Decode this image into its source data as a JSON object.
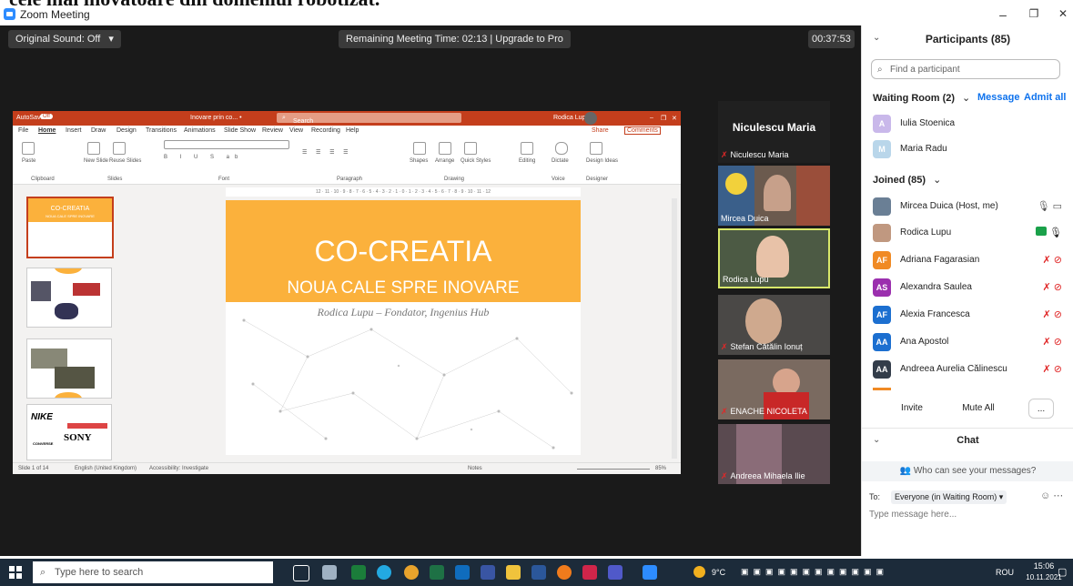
{
  "banner": {
    "text": "cele mai inovatoare din domeniul robotizat."
  },
  "window": {
    "title": "Zoom Meeting",
    "minimize": "–",
    "maximize": "❐",
    "close": "✕"
  },
  "meeting": {
    "sound": "Original Sound: Off",
    "sound_caret": "▾",
    "remaining": "Remaining Meeting Time: 02:13 | Upgrade to Pro",
    "timer": "00:37:53"
  },
  "ppt": {
    "autosave": "AutoSave",
    "autosave_state": "Off",
    "doc": "Inovare prin co... •",
    "search": "Search",
    "user": "Rodica Lupu",
    "menu": [
      "File",
      "Home",
      "Insert",
      "Draw",
      "Design",
      "Transitions",
      "Animations",
      "Slide Show",
      "Review",
      "View",
      "Recording",
      "Help"
    ],
    "share": "Share",
    "comments": "Comments",
    "groups": [
      "Clipboard",
      "Slides",
      "Font",
      "Paragraph",
      "Drawing",
      "Voice",
      "Designer"
    ],
    "tools": {
      "paste": "Paste",
      "new_slide": "New Slide",
      "reuse": "Reuse Slides",
      "shapes": "Shapes",
      "arrange": "Arrange",
      "quick_styles": "Quick Styles",
      "editing": "Editing",
      "dictate": "Dictate",
      "design_ideas": "Design Ideas"
    },
    "ruler": "12 · 11 · 10 · 9 · 8 · 7 · 6 · 5 · 4 · 3 · 2 · 1 · 0 · 1 · 2 · 3 · 4 · 5 · 6 · 7 · 8 · 9 · 10 · 11 · 12",
    "thumbs": [
      {
        "num": "1",
        "title": "CO-CREATIA",
        "subtitle": "NOUA CALE SPRE INOVARE"
      },
      {
        "num": "2"
      },
      {
        "num": "3"
      },
      {
        "num": "4",
        "brand1": "NIKE",
        "brand2": "SONY",
        "brand3": "CONVERSE"
      }
    ],
    "slide": {
      "title": "CO-CREATIA",
      "subtitle": "NOUA CALE SPRE INOVARE",
      "author": "Rodica Lupu – Fondator, Ingenius Hub"
    },
    "status": {
      "slide": "Slide 1 of 14",
      "lang": "English (United Kingdom)",
      "access": "Accessibility: Investigate",
      "notes": "Notes",
      "zoom": "85%"
    }
  },
  "tiles": [
    {
      "name": "Niculescu Maria",
      "header": "Niculescu Maria",
      "muted": true
    },
    {
      "name": "Mircea Duica",
      "muted": false
    },
    {
      "name": "Rodica Lupu",
      "muted": false,
      "active": true
    },
    {
      "name": "Stefan Cătălin Ionuț",
      "muted": true
    },
    {
      "name": "ENACHE NICOLETA",
      "muted": true
    },
    {
      "name": "Andreea Mihaela Ilie",
      "muted": true
    }
  ],
  "panel": {
    "title": "Participants (85)",
    "search_placeholder": "Find a participant",
    "waiting": "Waiting Room (2)",
    "message": "Message",
    "admit_all": "Admit all",
    "waiting_list": [
      {
        "initial": "A",
        "name": "Iulia Stoenica",
        "color": "#c9b8ea"
      },
      {
        "initial": "M",
        "name": "Maria Radu",
        "color": "#b9d6ea"
      }
    ],
    "joined": "Joined (85)",
    "joined_list": [
      {
        "initial": "",
        "name": "Mircea Duica (Host, me)",
        "color": "#6a7f95",
        "photo": true
      },
      {
        "initial": "",
        "name": "Rodica Lupu",
        "color": "#c09880",
        "photo": true
      },
      {
        "initial": "AF",
        "name": "Adriana Fagarasian",
        "color": "#f08a24"
      },
      {
        "initial": "AS",
        "name": "Alexandra Saulea",
        "color": "#9b2fae"
      },
      {
        "initial": "AF",
        "name": "Alexia Francesca",
        "color": "#1c6fd0"
      },
      {
        "initial": "AA",
        "name": "Ana Apostol",
        "color": "#1c6fd0"
      },
      {
        "initial": "AA",
        "name": "Andreea Aurelia Călinescu",
        "color": "#333d4a"
      }
    ],
    "invite": "Invite",
    "mute_all": "Mute All",
    "more": "...",
    "chat": "Chat",
    "who_can_see": "Who can see your messages?",
    "to_label": "To:",
    "to_value": "Everyone (in Waiting Room) ▾",
    "type_placeholder": "Type message here..."
  },
  "taskbar": {
    "search": "Type here to search",
    "weather": "9°C",
    "lang": "ROU",
    "time": "15:06",
    "date": "10.11.2021"
  },
  "colors": {
    "ppt": "#c43e1c",
    "slide_band": "#fbb13c",
    "zoom_blue": "#2d8cff",
    "active_tile": "#d8e86a"
  }
}
